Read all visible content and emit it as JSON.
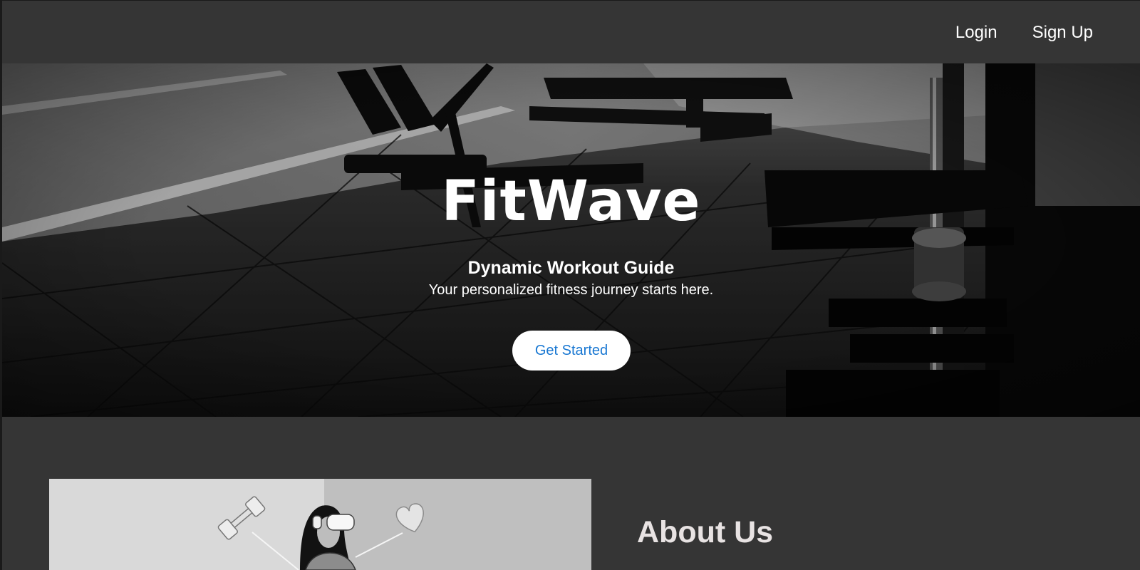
{
  "nav": {
    "login": "Login",
    "signup": "Sign Up"
  },
  "hero": {
    "brand": "FitWave",
    "tagline": "Dynamic Workout Guide",
    "subline": "Your personalized fitness journey starts here.",
    "cta": "Get Started"
  },
  "about": {
    "title": "About Us"
  },
  "colors": {
    "page_bg": "#353535",
    "cta_text": "#1877d2",
    "about_title": "#e8e3e3"
  }
}
